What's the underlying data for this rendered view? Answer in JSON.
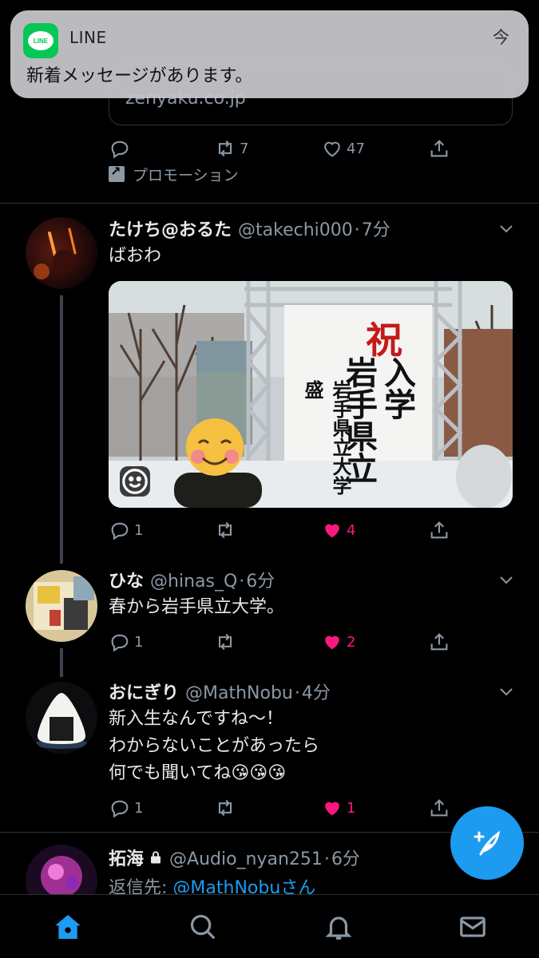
{
  "notification": {
    "app_name": "LINE",
    "app_icon_label": "LINE",
    "time": "今",
    "message": "新着メッセージがあります。"
  },
  "promoted_tweet": {
    "link_domain": "zenyaku.co.jp",
    "retweets": "7",
    "likes": "47",
    "promo_label": "プロモーション"
  },
  "tweets": [
    {
      "name": "たけち@おるた",
      "handle": "@takechi000",
      "time": "7分",
      "text": "ばおわ",
      "replies": "1",
      "retweets": "",
      "likes": "4",
      "liked": true,
      "photo": {
        "banner_lines": [
          "祝",
          "入学",
          "岩手県立",
          "岩手県立大学盛"
        ]
      }
    },
    {
      "name": "ひな",
      "handle": "@hinas_Q",
      "time": "6分",
      "text": "春から岩手県立大学。",
      "replies": "1",
      "retweets": "",
      "likes": "2",
      "liked": true
    },
    {
      "name": "おにぎり",
      "handle": "@MathNobu",
      "time": "4分",
      "text": "新入生なんですね〜！\nわからないことがあったら\n何でも聞いてね😘😘😘",
      "replies": "1",
      "retweets": "",
      "likes": "1",
      "liked": true
    },
    {
      "name": "拓海",
      "handle": "@Audio_nyan251",
      "time": "6分",
      "protected": true,
      "reply_prefix": "返信先: ",
      "reply_mention": "@MathNobuさん"
    }
  ],
  "colors": {
    "background": "#000000",
    "accent": "#1d9bf0",
    "like": "#f91880",
    "muted": "#8b98a5",
    "line_green": "#06c755"
  },
  "tabbar": [
    "home-icon",
    "search-icon",
    "bell-icon",
    "mail-icon"
  ]
}
